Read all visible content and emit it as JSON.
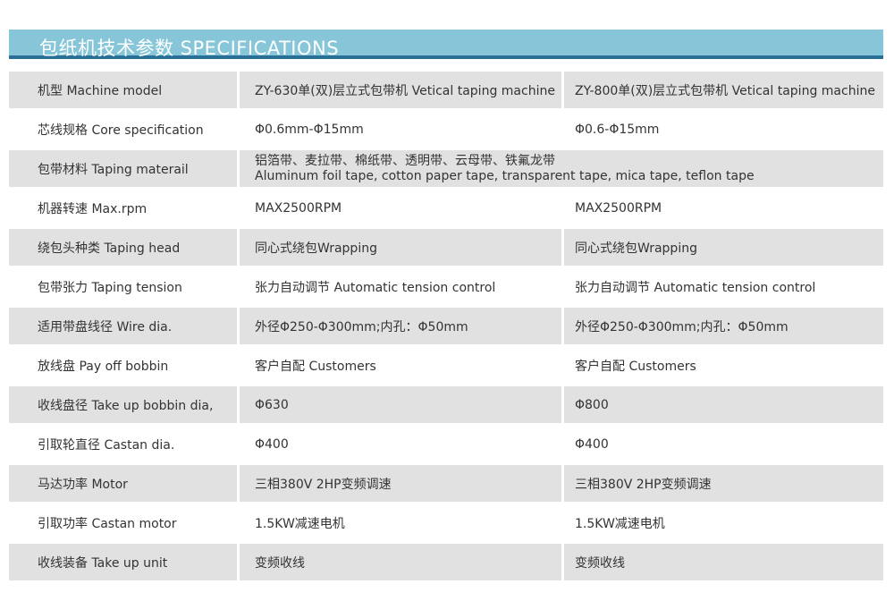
{
  "header": {
    "title": "包纸机技术参数  SPECIFICATIONS"
  },
  "rows": [
    {
      "label": "机型 Machine model",
      "v1": "ZY-630单(双)层立式包带机 Vetical taping machine",
      "v2": "ZY-800单(双)层立式包带机 Vetical taping machine"
    },
    {
      "label": "芯线规格 Core specification",
      "v1": "Φ0.6mm-Φ15mm",
      "v2": "Φ0.6-Φ15mm"
    },
    {
      "label": "包带材料 Taping materail",
      "merged_line1": "铝箔带、麦拉带、棉纸带、透明带、云母带、铁氟龙带",
      "merged_line2": "Aluminum foil tape, cotton paper tape, transparent tape, mica tape, teflon tape"
    },
    {
      "label": "机器转速 Max.rpm",
      "v1": "MAX2500RPM",
      "v2": "MAX2500RPM"
    },
    {
      "label": "绕包头种类 Taping head",
      "v1": "同心式绕包Wrapping",
      "v2": "同心式绕包Wrapping"
    },
    {
      "label": "包带张力 Taping tension",
      "v1": "张力自动调节 Automatic tension control",
      "v2": "张力自动调节 Automatic tension control"
    },
    {
      "label": "适用带盘线径 Wire dia.",
      "v1": "外径Φ250-Φ300mm;内孔：Φ50mm",
      "v2": "外径Φ250-Φ300mm;内孔：Φ50mm"
    },
    {
      "label": "放线盘 Pay off bobbin",
      "v1": "客户自配 Customers",
      "v2": "客户自配 Customers"
    },
    {
      "label": "收线盘径 Take up bobbin dia,",
      "v1": "Φ630",
      "v2": "Φ800"
    },
    {
      "label": "引取轮直径 Castan dia.",
      "v1": "Φ400",
      "v2": "Φ400"
    },
    {
      "label": "马达功率 Motor",
      "v1": "三相380V 2HP变频调速",
      "v2": "三相380V 2HP变频调速"
    },
    {
      "label": "引取功率 Castan motor",
      "v1": "1.5KW减速电机",
      "v2": "1.5KW减速电机"
    },
    {
      "label": "收线装备 Take up unit",
      "v1": "变频收线",
      "v2": "变频收线"
    }
  ]
}
